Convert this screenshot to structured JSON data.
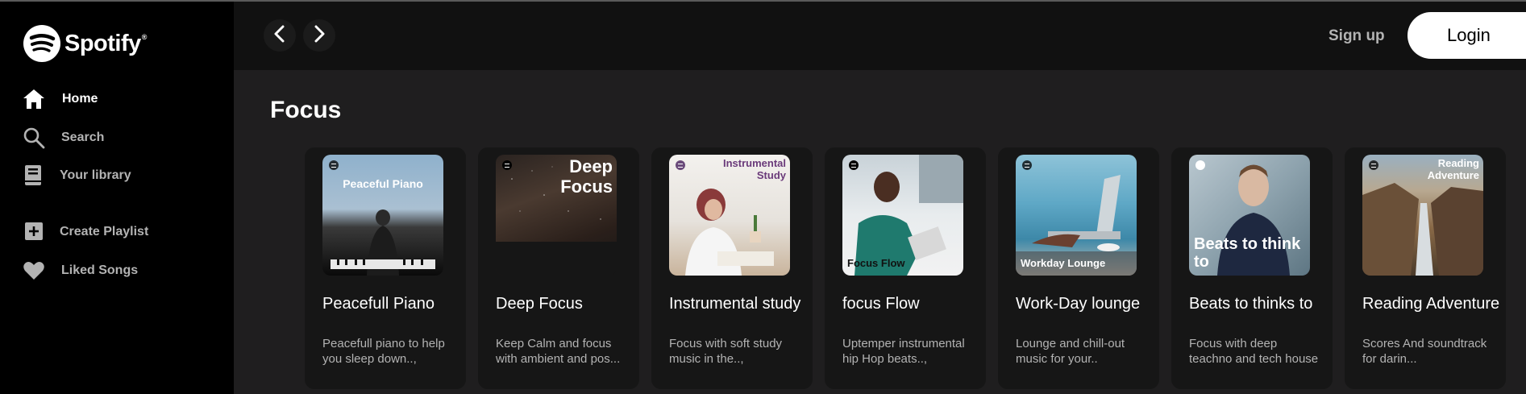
{
  "app": {
    "name": "Spotify"
  },
  "sidebar": {
    "items": [
      {
        "label": "Home",
        "icon": "home-icon",
        "active": true
      },
      {
        "label": "Search",
        "icon": "search-icon",
        "active": false
      },
      {
        "label": "Your library",
        "icon": "library-icon",
        "active": false
      },
      {
        "label": "Create Playlist",
        "icon": "plus-square-icon",
        "active": false
      },
      {
        "label": "Liked Songs",
        "icon": "heart-icon",
        "active": false
      }
    ]
  },
  "topbar": {
    "back_icon": "chevron-left-icon",
    "forward_icon": "chevron-right-icon",
    "signup_label": "Sign up",
    "login_label": "Login"
  },
  "section": {
    "title": "Focus"
  },
  "cards": [
    {
      "title": "Peacefull Piano",
      "description": "Peacefull piano to help you sleep down..,",
      "cover_text": "Peaceful Piano"
    },
    {
      "title": "Deep Focus",
      "description": "Keep Calm and focus with ambient and pos...",
      "cover_text": "Deep Focus"
    },
    {
      "title": "Instrumental study",
      "description": "Focus with soft study music in the..,",
      "cover_text": "Instrumental Study"
    },
    {
      "title": "focus Flow",
      "description": "Uptemper instrumental hip Hop beats..,",
      "cover_text": "Focus Flow"
    },
    {
      "title": "Work-Day lounge",
      "description": "Lounge and chill-out music for your..",
      "cover_text": "Workday Lounge"
    },
    {
      "title": "Beats to thinks to",
      "description": "Focus with deep teachno and tech house",
      "cover_text": "Beats to think to"
    },
    {
      "title": "Reading Adventure",
      "description": "Scores And soundtrack for darin...",
      "cover_text": "Reading Adventure"
    }
  ],
  "colors": {
    "background": "#121212",
    "sidebar": "#000000",
    "card": "#161616",
    "accent": "#ffffff"
  }
}
